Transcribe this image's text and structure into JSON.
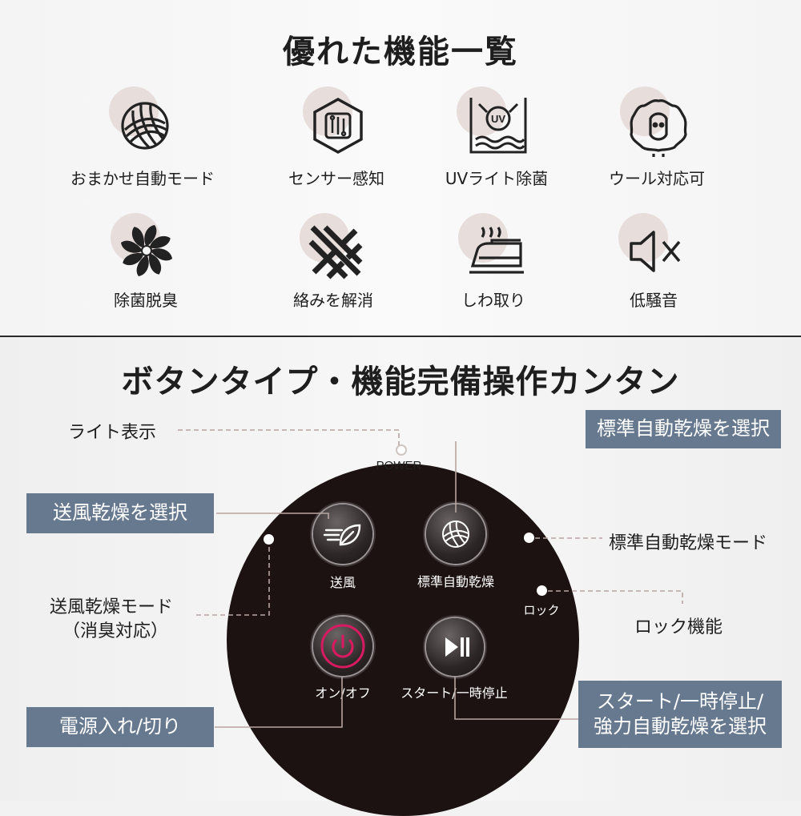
{
  "section1": {
    "title": "優れた機能一覧",
    "features": [
      {
        "label": "おまかせ自動モード",
        "icon": "wool-yarn-icon"
      },
      {
        "label": "センサー感知",
        "icon": "sensor-chip-icon"
      },
      {
        "label": "UVライト除菌",
        "icon": "uv-light-icon"
      },
      {
        "label": "ウール対応可",
        "icon": "sheep-wool-icon"
      },
      {
        "label": "除菌脱臭",
        "icon": "pinwheel-icon"
      },
      {
        "label": "絡みを解消",
        "icon": "untangle-icon"
      },
      {
        "label": "しわ取り",
        "icon": "iron-icon"
      },
      {
        "label": "低騒音",
        "icon": "mute-speaker-icon"
      }
    ]
  },
  "section2": {
    "title": "ボタンタイプ・機能完備操作カンタン",
    "panel": {
      "power_label": "POWER",
      "buttons": {
        "air": "送風",
        "standard": "標準自動乾燥",
        "power": "オン/オフ",
        "start": "スタート/一時停止"
      },
      "lock_label": "ロック"
    },
    "callouts": {
      "light": "ライト表示",
      "select_standard": "標準自動乾燥を選択",
      "select_air": "送風乾燥を選択",
      "standard_mode": "標準自動乾燥モード",
      "air_mode_line1": "送風乾燥モード",
      "air_mode_line2": "（消臭対応）",
      "lock": "ロック機能",
      "power_switch": "電源入れ/切り",
      "start_line1": "スタート/一時停止/",
      "start_line2": "強力自動乾燥を選択"
    }
  },
  "colors": {
    "panel": "#1c1211",
    "callout_box": "#67798f",
    "blob": "#e7dedb",
    "power_accent": "#d81b60",
    "leader_line": "#b8a4a0"
  }
}
